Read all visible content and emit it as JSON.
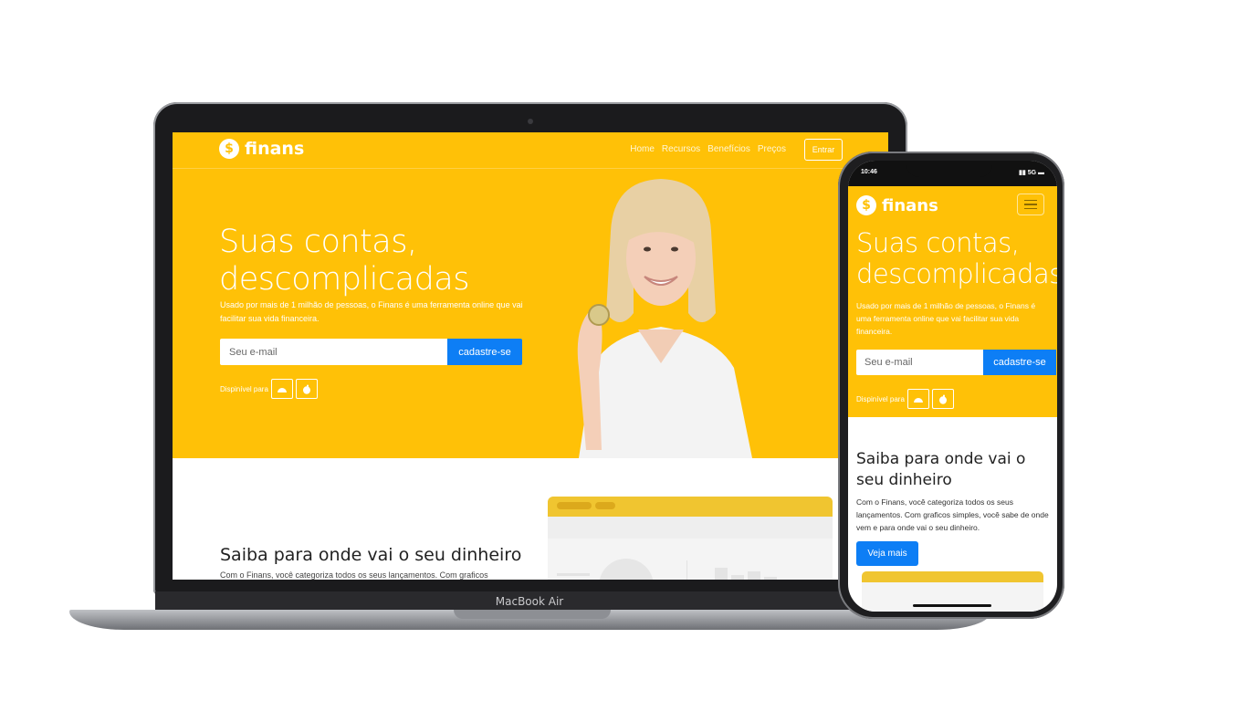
{
  "laptop": {
    "brand": "MacBook Air",
    "site": {
      "logo_symbol": "$",
      "logo_text": "finans",
      "nav": [
        "Home",
        "Recursos",
        "Benefícios",
        "Preços"
      ],
      "login_label": "Entrar",
      "hero_title_line1": "Suas contas,",
      "hero_title_line2": "descomplicadas",
      "hero_subtitle": "Usado por mais de 1 milhão de pessoas, o Finans é uma ferramenta online que vai facilitar sua vida financeira.",
      "email_placeholder": "Seu e-mail",
      "signup_label": "cadastre-se",
      "available_label": "Dispinível para",
      "section2_title": "Saiba para onde vai o seu dinheiro",
      "section2_text": "Com o Finans, você categoriza todos os seus lançamentos. Com graficos"
    }
  },
  "phone": {
    "time": "10:46",
    "signal": "5G",
    "site": {
      "logo_symbol": "$",
      "logo_text": "finans",
      "hero_title_line1": "Suas contas,",
      "hero_title_line2": "descomplicadas",
      "hero_subtitle": "Usado por mais de 1 milhão de pessoas, o Finans é uma ferramenta online que vai facilitar sua vida financeira.",
      "email_placeholder": "Seu e-mail",
      "signup_label": "cadastre-se",
      "available_label": "Dispinível para",
      "section2_title": "Saiba para onde vai o seu dinheiro",
      "section2_text": "Com o Finans, você categoriza todos os seus lançamentos. Com graficos simples, você sabe de onde vem e para onde vai o seu dinheiro.",
      "cta_label": "Veja mais"
    }
  },
  "icons": {
    "android": "android-icon",
    "apple": "apple-icon",
    "menu": "hamburger-menu-icon"
  },
  "colors": {
    "brand_yellow": "#ffc107",
    "primary_blue": "#0d7ef5"
  }
}
